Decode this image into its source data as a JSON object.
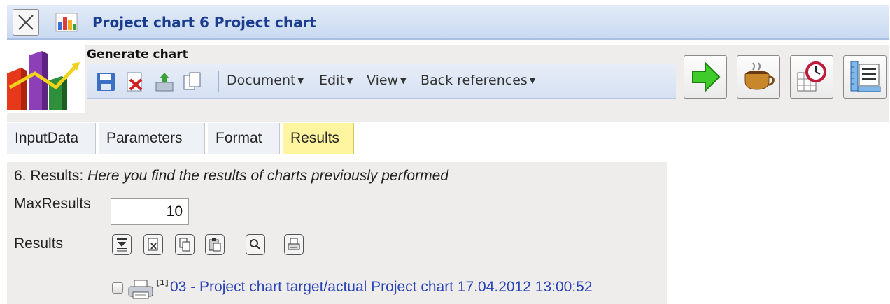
{
  "window": {
    "title": "Project chart 6 Project chart"
  },
  "toolbar": {
    "section_label": "Generate chart",
    "menus": [
      {
        "label": "Document"
      },
      {
        "label": "Edit"
      },
      {
        "label": "View"
      },
      {
        "label": "Back references"
      }
    ],
    "icons": [
      "save-icon",
      "delete-icon",
      "export-icon",
      "copy-icon"
    ],
    "big_buttons": [
      "run-icon",
      "coffee-icon",
      "scheduler-icon",
      "ruler-list-icon"
    ]
  },
  "tabs": [
    {
      "label": "InputData"
    },
    {
      "label": "Parameters"
    },
    {
      "label": "Format"
    },
    {
      "label": "Results",
      "active": true
    }
  ],
  "results_panel": {
    "heading_prefix": "6. Results: ",
    "heading_italic": "Here you find the results of charts previously performed",
    "max_results_label": "MaxResults",
    "max_results_value": "10",
    "results_label": "Results",
    "action_icons": [
      "download-icon",
      "delete-doc-icon",
      "copy-doc-icon",
      "paste-doc-icon",
      "search-icon",
      "print-doc-icon"
    ],
    "items": [
      {
        "index_marker": "[1]",
        "text": "03 - Project chart target/actual Project chart 17.04.2012 13:00:52"
      }
    ]
  },
  "colors": {
    "title_text": "#1a3d8f",
    "link": "#2a45b8",
    "active_tab": "#fff5a0",
    "panel_bg": "#efecec"
  }
}
